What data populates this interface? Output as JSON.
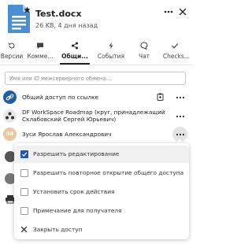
{
  "file": {
    "name": "Test.docx",
    "meta": "26 KB, 4 дня назад",
    "icon": "document-icon",
    "starred": true
  },
  "header_actions": {
    "more_icon": "dots-horizontal-icon",
    "close_icon": "close-icon"
  },
  "tabs": [
    {
      "label": "Версии",
      "icon": "history-icon",
      "active": false
    },
    {
      "label": "Комме...",
      "icon": "comment-icon",
      "active": false
    },
    {
      "label": "Общи...",
      "icon": "share-icon",
      "active": true
    },
    {
      "label": "События",
      "icon": "activity-icon",
      "active": false
    },
    {
      "label": "Чат",
      "icon": "chat-icon",
      "active": false
    },
    {
      "label": "Checks...",
      "icon": "check-icon",
      "active": false
    }
  ],
  "search": {
    "value": "",
    "placeholder": "Имя или ID межсерверного обмена..."
  },
  "shares": [
    {
      "type": "link",
      "label": "Общий доступ по ссылке",
      "icon": "link-icon"
    },
    {
      "type": "circle",
      "label_line1": "DF WorkSpace Roadmap (круг, принадлежащий",
      "label_line2": "Склабовский Сергей Юрьевич)",
      "icon": "circle-group-icon"
    },
    {
      "type": "user",
      "label": "Зуси Ярослав Александрович",
      "initials": "ЗЯ",
      "avatar_color": "#e8c9a0"
    }
  ],
  "menu": {
    "items": [
      {
        "label": "Разрешить редактирование",
        "checked": true
      },
      {
        "label": "Разрешить повторное открытие общего доступа",
        "checked": false
      },
      {
        "label": "Установить срок действия",
        "checked": false
      },
      {
        "label": "Примечание для получателя",
        "checked": false
      },
      {
        "label": "Закрыть доступ",
        "icon": "close-icon"
      }
    ]
  },
  "colors": {
    "accent": "#1a5bb5",
    "file_icon": "#4a8fd6",
    "link_avatar": "#1e5ea8",
    "circle_avatar": "#e9e9e9",
    "user_avatar": "#e8c9a0"
  }
}
